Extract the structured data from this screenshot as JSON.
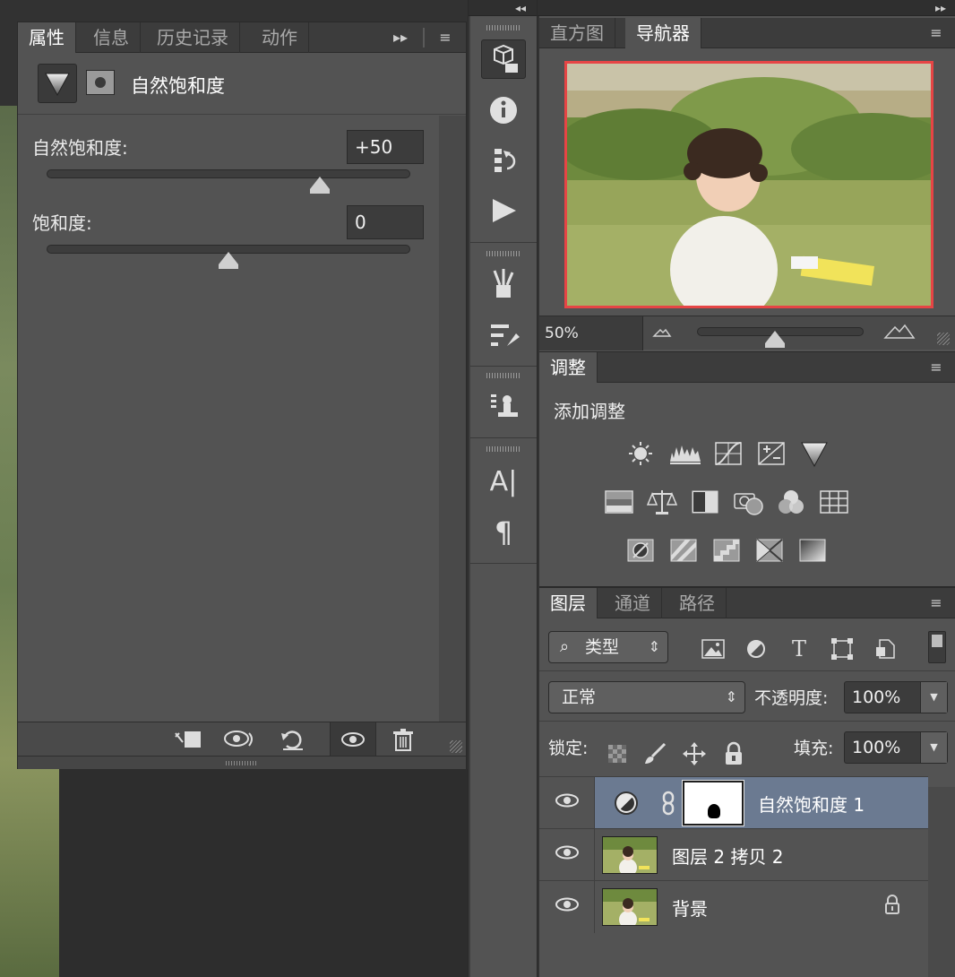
{
  "properties_panel": {
    "tabs": [
      {
        "label": "属性",
        "active": true
      },
      {
        "label": "信息",
        "active": false
      },
      {
        "label": "历史记录",
        "active": false
      },
      {
        "label": "动作",
        "active": false
      }
    ],
    "header_title": "自然饱和度",
    "sliders": [
      {
        "label": "自然饱和度:",
        "value": "+50",
        "position_fraction": 0.75
      },
      {
        "label": "饱和度:",
        "value": "0",
        "position_fraction": 0.5
      }
    ],
    "footer_icons": [
      "clip-to-layer-icon",
      "view-previous-state-icon",
      "reset-icon",
      "visibility-eye-icon",
      "trash-icon"
    ]
  },
  "navigator_panel": {
    "tabs": [
      {
        "label": "直方图",
        "active": false
      },
      {
        "label": "导航器",
        "active": true
      }
    ],
    "zoom": "50%",
    "zoom_slider_fraction": 0.45,
    "view_box_color": "#e64545"
  },
  "adjustments_panel": {
    "tab_label": "调整",
    "heading": "添加调整",
    "row1": [
      "brightness-contrast-icon",
      "levels-icon",
      "curves-icon",
      "exposure-icon",
      "vibrance-icon"
    ],
    "row2": [
      "hue-saturation-icon",
      "color-balance-icon",
      "black-white-icon",
      "photo-filter-icon",
      "channel-mixer-icon",
      "color-lookup-icon"
    ],
    "row3": [
      "invert-icon",
      "posterize-icon",
      "threshold-icon",
      "selective-color-icon",
      "gradient-map-icon"
    ]
  },
  "layers_panel": {
    "tabs": [
      {
        "label": "图层",
        "active": true
      },
      {
        "label": "通道",
        "active": false
      },
      {
        "label": "路径",
        "active": false
      }
    ],
    "filter_label": "类型",
    "blend_mode": "正常",
    "opacity_label": "不透明度:",
    "opacity_value": "100%",
    "lock_label": "锁定:",
    "fill_label": "填充:",
    "fill_value": "100%",
    "layers": [
      {
        "name": "自然饱和度 1",
        "selected": true,
        "type": "adjustment"
      },
      {
        "name": "图层 2 拷贝 2",
        "selected": false,
        "type": "pixel"
      },
      {
        "name": "背景",
        "selected": false,
        "type": "background",
        "locked": true
      }
    ],
    "selected_color": "#6b7a91"
  },
  "icons": {
    "panel_menu": "≡",
    "double_arrow": "▸▸",
    "collapse_left": "◂◂",
    "collapse_right": "▸▸",
    "eye": "👁",
    "chain": "⛓",
    "lock": "🔒",
    "stepper": "⇕",
    "dropdown": "▼"
  },
  "colors": {
    "panel_bg": "#535353",
    "tab_bg": "#3c3c3c",
    "accent_red": "#e64545"
  }
}
